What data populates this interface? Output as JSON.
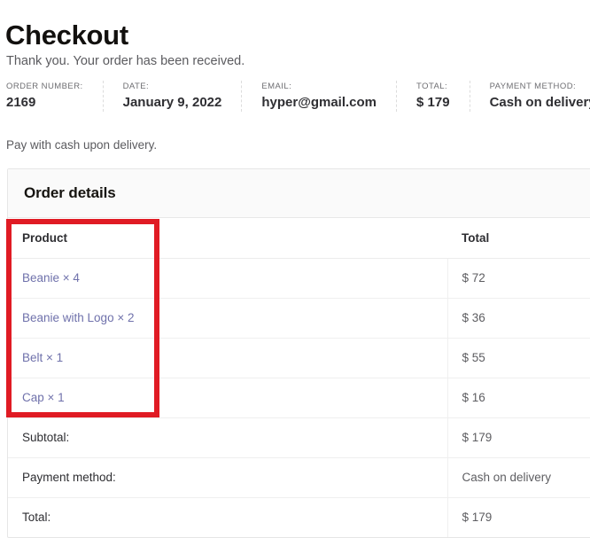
{
  "page": {
    "title": "Checkout",
    "thank_you": "Thank you. Your order has been received.",
    "pay_note": "Pay with cash upon delivery."
  },
  "order_info": [
    {
      "label": "ORDER NUMBER:",
      "value": "2169",
      "name": "order-number"
    },
    {
      "label": "DATE:",
      "value": "January 9, 2022",
      "name": "order-date"
    },
    {
      "label": "EMAIL:",
      "value": "hyper@gmail.com",
      "name": "order-email"
    },
    {
      "label": "TOTAL:",
      "value": "$ 179",
      "name": "order-total"
    },
    {
      "label": "PAYMENT METHOD:",
      "value": "Cash on delivery",
      "name": "order-payment-method"
    }
  ],
  "order_details": {
    "heading": "Order details",
    "columns": {
      "product": "Product",
      "total": "Total"
    },
    "items": [
      {
        "name": "Beanie",
        "quantity_label": "Beanie × 4",
        "total": "$ 72"
      },
      {
        "name": "Beanie with Logo",
        "quantity_label": "Beanie with Logo × 2",
        "total": "$ 36"
      },
      {
        "name": "Belt",
        "quantity_label": "Belt × 1",
        "total": "$ 55"
      },
      {
        "name": "Cap",
        "quantity_label": "Cap × 1",
        "total": "$ 16"
      }
    ],
    "footer": [
      {
        "label": "Subtotal:",
        "value": "$ 179"
      },
      {
        "label": "Payment method:",
        "value": "Cash on delivery"
      },
      {
        "label": "Total:",
        "value": "$ 179"
      }
    ]
  },
  "annotation": {
    "color": "#e01b24",
    "target": "product-column"
  }
}
